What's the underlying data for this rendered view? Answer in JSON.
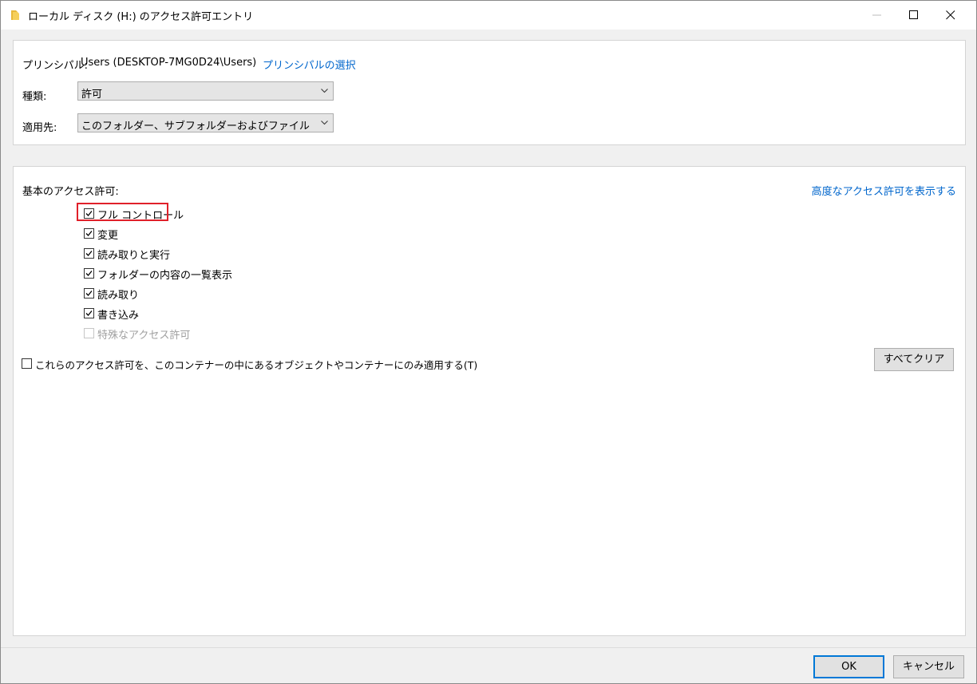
{
  "window": {
    "title": "ローカル ディスク (H:) のアクセス許可エントリ",
    "folder_icon_color": "#e8b83a"
  },
  "principal": {
    "label": "プリンシパル:",
    "value": "Users (DESKTOP-7MG0D24\\Users)",
    "select_link": "プリンシパルの選択"
  },
  "type": {
    "label": "種類:",
    "value": "許可"
  },
  "applies_to": {
    "label": "適用先:",
    "value": "このフォルダー、サブフォルダーおよびファイル"
  },
  "basic_permissions": {
    "heading": "基本のアクセス許可:",
    "advanced_link": "高度なアクセス許可を表示する",
    "items": [
      {
        "label": "フル コントロール",
        "checked": true,
        "enabled": true
      },
      {
        "label": "変更",
        "checked": true,
        "enabled": true
      },
      {
        "label": "読み取りと実行",
        "checked": true,
        "enabled": true
      },
      {
        "label": "フォルダーの内容の一覧表示",
        "checked": true,
        "enabled": true
      },
      {
        "label": "読み取り",
        "checked": true,
        "enabled": true
      },
      {
        "label": "書き込み",
        "checked": true,
        "enabled": true
      },
      {
        "label": "特殊なアクセス許可",
        "checked": false,
        "enabled": false
      }
    ]
  },
  "apply_only_container": {
    "label": "これらのアクセス許可を、このコンテナーの中にあるオブジェクトやコンテナーにのみ適用する(T)",
    "checked": false
  },
  "buttons": {
    "clear_all": "すべてクリア",
    "ok": "OK",
    "cancel": "キャンセル"
  },
  "colors": {
    "link": "#0066cc",
    "highlight": "#e0202a",
    "default_button_border": "#0078d7"
  }
}
